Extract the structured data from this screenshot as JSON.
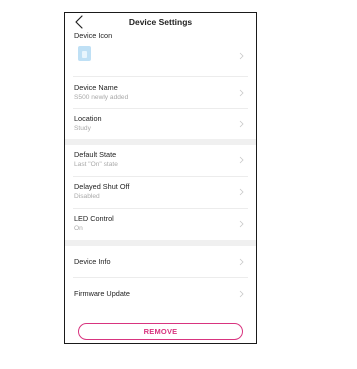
{
  "header": {
    "title": "Device Settings"
  },
  "device_icon": {
    "label": "Device Icon"
  },
  "rows": {
    "device_name": {
      "title": "Device Name",
      "value": "S500 newly added"
    },
    "location": {
      "title": "Location",
      "value": "Study"
    },
    "default_state": {
      "title": "Default State",
      "value": "Last \"On\" state"
    },
    "delayed_shut_off": {
      "title": "Delayed Shut Off",
      "value": "Disabled"
    },
    "led_control": {
      "title": "LED Control",
      "value": "On"
    },
    "device_info": {
      "title": "Device Info"
    },
    "firmware_update": {
      "title": "Firmware Update"
    }
  },
  "actions": {
    "remove_label": "REMOVE"
  },
  "colors": {
    "accent": "#d8347f",
    "icon_tile": "#bfe0f5",
    "section_gap": "#f0f0f0"
  }
}
